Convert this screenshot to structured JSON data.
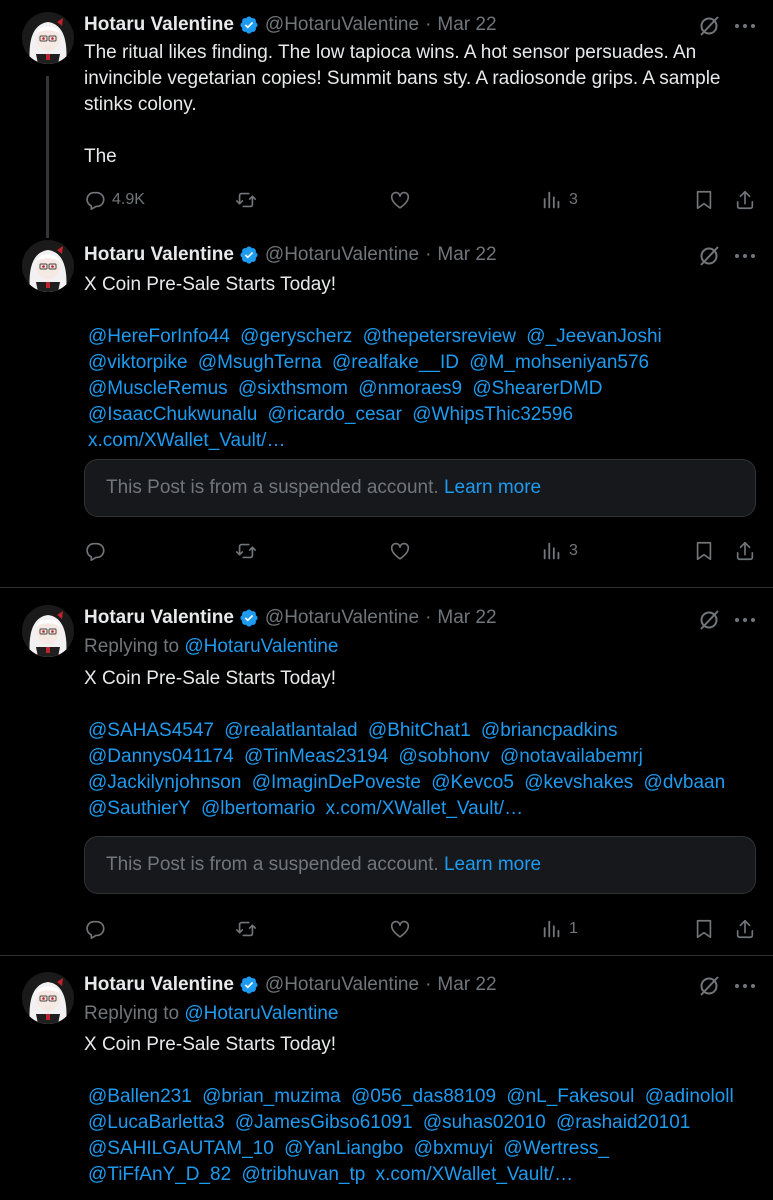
{
  "author": {
    "name": "Hotaru Valentine",
    "handle": "@HotaruValentine",
    "dot": "·"
  },
  "tweets": [
    {
      "date": "Mar 22",
      "text_line1": "The ritual likes finding. The low tapioca wins. A hot sensor persuades. An invincible vegetarian copies! Summit bans sty. A radiosonde grips. A sample stinks colony.",
      "text_line2": "The",
      "replies": "4.9K",
      "views": "3"
    },
    {
      "date": "Mar 22",
      "headline": "X Coin Pre-Sale Starts Today!",
      "mentions": [
        "@HereForInfo44",
        "@geryscherz",
        "@thepetersreview",
        "@_JeevanJoshi",
        "@viktorpike",
        "@MsughTerna",
        "@realfake__ID",
        "@M_mohseniyan576",
        "@MuscleRemus",
        "@sixthsmom",
        "@nmoraes9",
        "@ShearerDMD",
        "@IsaacChukwunalu",
        "@ricardo_cesar",
        "@WhipsThic32596",
        "x.com/XWallet_Vault/…"
      ],
      "suspended_text": "This Post is from a suspended account.",
      "learn_more": "Learn more",
      "views": "3"
    },
    {
      "date": "Mar 22",
      "replying_label": "Replying to",
      "replying_handle": "@HotaruValentine",
      "headline": "X Coin Pre-Sale Starts Today!",
      "mentions": [
        "@SAHAS4547",
        "@realatlantalad",
        "@BhitChat1",
        "@briancpadkins",
        "@Dannys041174",
        "@TinMeas23194",
        "@sobhonv",
        "@notavailabemrj",
        "@Jackilynjohnson",
        "@ImaginDePoveste",
        "@Kevco5",
        "@kevshakes",
        "@dvbaan",
        "@SauthierY",
        "@lbertomario",
        "x.com/XWallet_Vault/…"
      ],
      "suspended_text": "This Post is from a suspended account.",
      "learn_more": "Learn more",
      "views": "1"
    },
    {
      "date": "Mar 22",
      "replying_label": "Replying to",
      "replying_handle": "@HotaruValentine",
      "headline": "X Coin Pre-Sale Starts Today!",
      "mentions": [
        "@Ballen231",
        "@brian_muzima",
        "@056_das88109",
        "@nL_Fakesoul",
        "@adinololl",
        "@LucaBarletta3",
        "@JamesGibso61091",
        "@suhas02010",
        "@rashaid20101",
        "@SAHILGAUTAM_10",
        "@YanLiangbo",
        "@bxmuyi",
        "@Wertress_",
        "@TiFfAnY_D_82",
        "@tribhuvan_tp",
        "x.com/XWallet_Vault/…"
      ]
    }
  ],
  "icons": [
    "verified-badge-icon",
    "grok-icon",
    "more-icon",
    "reply-icon",
    "repost-icon",
    "like-icon",
    "views-icon",
    "bookmark-icon",
    "share-icon"
  ],
  "colors": {
    "background": "#000000",
    "text": "#e7e9ea",
    "muted": "#71767b",
    "accent": "#1d9bf0",
    "border": "#2f3336"
  }
}
